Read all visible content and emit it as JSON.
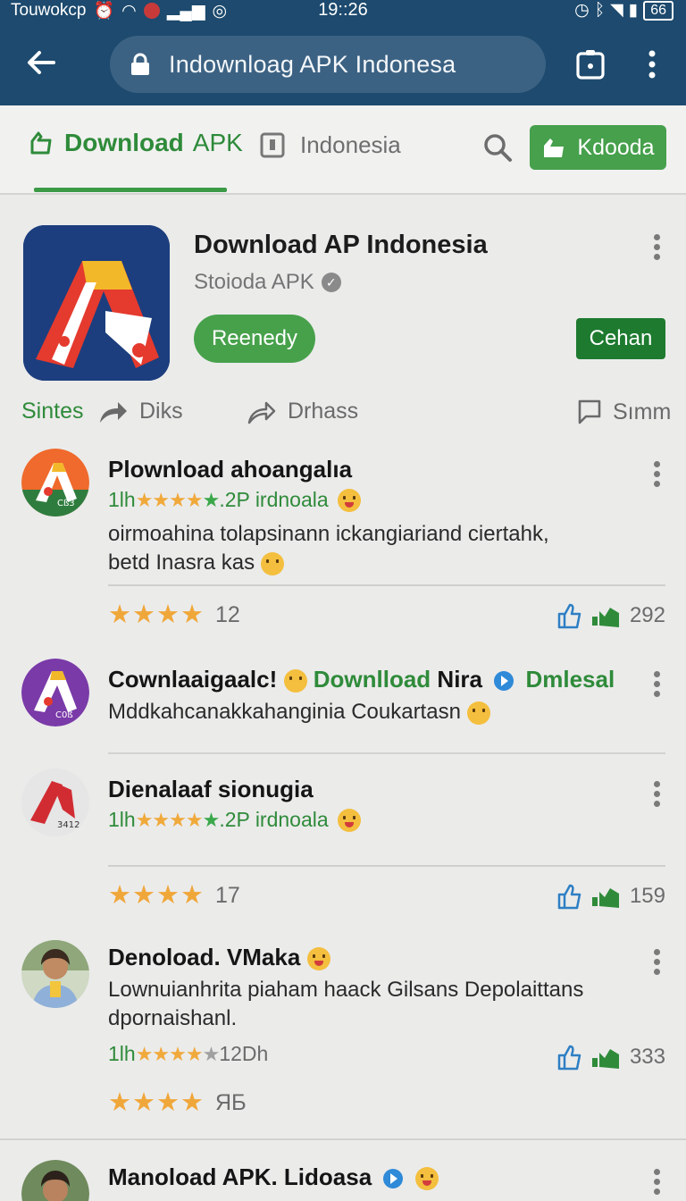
{
  "status": {
    "carrier": "Touwokcp",
    "time": "19::26",
    "battery": "66"
  },
  "browser": {
    "url": "Indownloag APK Indonesa"
  },
  "tabs": {
    "tab1_a": "Download",
    "tab1_b": "APK",
    "tab2": "Indonesia",
    "action_button": "Kdooda"
  },
  "app": {
    "title": "Download AP Indonesia",
    "subtitle": "Stoioda APK",
    "primary_button": "Reenedy",
    "secondary_button": "Cehan"
  },
  "actions": {
    "a1": "Sintes",
    "a2": "Diks",
    "a3": "Drhass",
    "a4": "Sımm"
  },
  "items": [
    {
      "title": "Plownload ahoangalıa",
      "meta_prefix": "1lh",
      "meta_suffix": ".2P irdnoala",
      "body": "oirmoahina tolapsinann ickangiariand ciertahk, betd Inasra kas",
      "rating_count": "12",
      "likes": "292",
      "badge_text": "Cß3",
      "colors": {
        "ring": "#ef6a2c",
        "fill": "#2f7d3e"
      }
    },
    {
      "title": "Cownlaaigaalc!",
      "title_green": "Downlload",
      "title_tail": "Nira",
      "title_green2": "Dmlesal",
      "body": "Mddkahcanakkahanginia Coukartasn",
      "badge_text": "C0ß",
      "colors": {
        "ring": "#7a3aa8"
      }
    },
    {
      "title": "Dienalaaf sionugia",
      "meta_prefix": "1lh",
      "meta_suffix": ".2P irdnoala",
      "rating_count": "17",
      "likes": "159",
      "badge_text": "3412",
      "colors": {
        "ring": "#e3e3e3"
      }
    },
    {
      "title": "Denoload. VMaka",
      "body": "Lownuianhrita piaham haack Gilsans Depolaittans dpornaishanl.",
      "meta_prefix": "1lh",
      "meta_suffix": "12Dh",
      "rating_count": "ЯƂ",
      "likes": "333"
    },
    {
      "title": "Manoload APK. Lidoasa"
    }
  ],
  "colors": {
    "topbar": "#1d4a6e",
    "green": "#2f8b3a",
    "button_green": "#46a04c",
    "star": "#f0a73a"
  }
}
